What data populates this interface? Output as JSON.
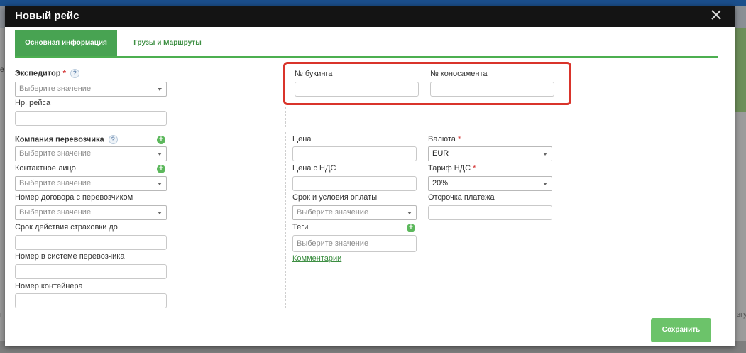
{
  "background": {
    "left_text": "е",
    "left_text2": "г",
    "right_text": "згу"
  },
  "modal": {
    "title": "Новый рейс",
    "tabs": [
      {
        "label": "Основная информация",
        "active": true
      },
      {
        "label": "Грузы и Маршруты",
        "active": false
      }
    ]
  },
  "form": {
    "forwarder": {
      "label": "Экспедитор",
      "required_mark": "*",
      "help": "?",
      "placeholder": "Выберите значение"
    },
    "voyage_no": {
      "label": "Нр. рейса",
      "value": ""
    },
    "booking_no": {
      "label": "№ букинга",
      "value": ""
    },
    "bill_of_lading_no": {
      "label": "№ коносамента",
      "value": ""
    },
    "carrier_company": {
      "label": "Компания перевозчика",
      "help": "?",
      "placeholder": "Выберите значение"
    },
    "contact_person": {
      "label": "Контактное лицо",
      "placeholder": "Выберите значение"
    },
    "carrier_contract_no": {
      "label": "Номер договора с перевозчиком",
      "placeholder": "Выберите значение"
    },
    "insurance_valid_until": {
      "label": "Срок действия страховки до",
      "value": ""
    },
    "carrier_system_no": {
      "label": "Номер в системе перевозчика",
      "value": ""
    },
    "container_no": {
      "label": "Номер контейнера",
      "value": ""
    },
    "price": {
      "label": "Цена",
      "value": ""
    },
    "price_with_vat": {
      "label": "Цена с НДС",
      "value": ""
    },
    "payment_terms": {
      "label": "Срок и условия оплаты",
      "placeholder": "Выберите значение"
    },
    "tags": {
      "label": "Теги",
      "placeholder": "Выберите значение"
    },
    "comments_link": "Комментарии",
    "currency": {
      "label": "Валюта",
      "required_mark": "*",
      "value": "EUR"
    },
    "vat_rate": {
      "label": "Тариф НДС",
      "required_mark": "*",
      "value": "20%"
    },
    "payment_delay": {
      "label": "Отсрочка платежа",
      "value": ""
    }
  },
  "actions": {
    "save_label": "Сохранить"
  },
  "colors": {
    "accent_green": "#48a352",
    "highlight_red": "#d9342b",
    "header_dark": "#141414"
  }
}
